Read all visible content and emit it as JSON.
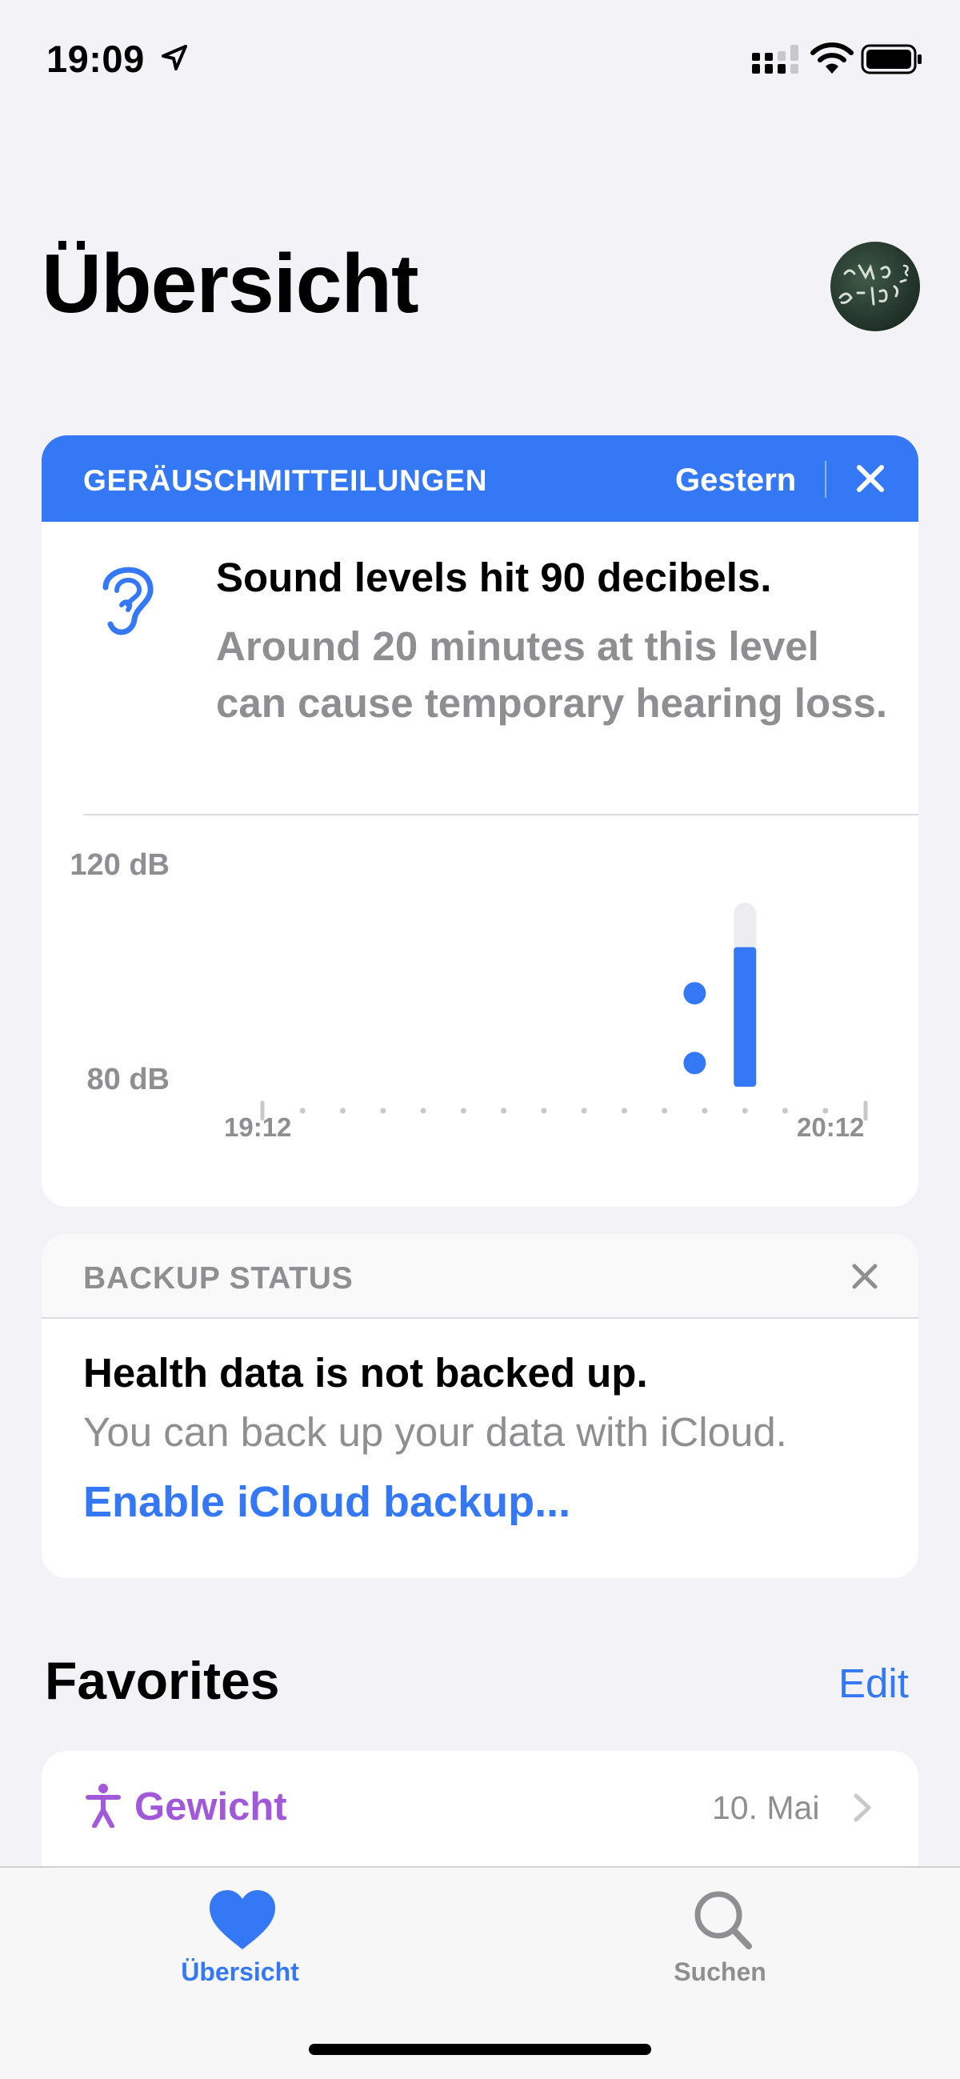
{
  "status_bar": {
    "time": "19:09"
  },
  "header": {
    "title": "Übersicht"
  },
  "noise_card": {
    "header_title": "GERÄUSCHMITTEILUNGEN",
    "header_date": "Gestern",
    "headline": "Sound levels hit 90 decibels.",
    "body": "Around 20 minutes at this level can cause temporary hearing loss.",
    "accent_color": "#3478f6"
  },
  "chart_data": {
    "type": "bar",
    "title": "",
    "ylabel": "",
    "y_ticks": [
      "120 dB",
      "80 dB"
    ],
    "x_ticks": [
      "19:12",
      "20:12"
    ],
    "ylim": [
      80,
      120
    ],
    "series": [
      {
        "values": [
          {
            "time": "19:55",
            "min": 85,
            "max": 88
          },
          {
            "time": "19:55",
            "min": 101,
            "max": 104
          },
          {
            "time": "20:00",
            "min": 80,
            "max": 112
          }
        ]
      }
    ]
  },
  "backup_card": {
    "header_title": "BACKUP STATUS",
    "headline": "Health data is not backed up.",
    "body": "You can back up your data with iCloud.",
    "link": "Enable iCloud backup..."
  },
  "favorites": {
    "title": "Favorites",
    "edit_label": "Edit",
    "items": [
      {
        "label": "Gewicht",
        "date": "10. Mai",
        "icon": "person-figure-icon",
        "color": "#a259d9"
      }
    ]
  },
  "tab_bar": {
    "tabs": [
      {
        "label": "Übersicht",
        "icon": "heart-icon",
        "active": true
      },
      {
        "label": "Suchen",
        "icon": "search-icon",
        "active": false
      }
    ]
  }
}
